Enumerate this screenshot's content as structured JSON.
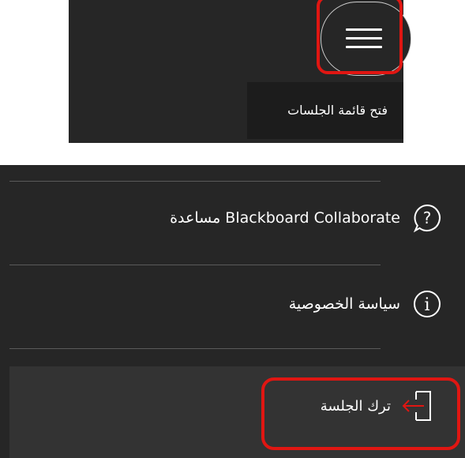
{
  "top": {
    "menu_button_icon": "hamburger-icon",
    "tooltip": "فتح قائمة الجلسات"
  },
  "menu": {
    "items": [
      {
        "label": "مساعدة Blackboard Collaborate",
        "icon": "help-circle-icon"
      },
      {
        "label": "سياسة الخصوصية",
        "icon": "info-circle-icon"
      }
    ],
    "leave": {
      "label": "ترك الجلسة",
      "icon": "leave-session-icon"
    }
  },
  "colors": {
    "panel": "#262626",
    "highlight": "#e01612",
    "leave_arrow": "#e01612"
  }
}
